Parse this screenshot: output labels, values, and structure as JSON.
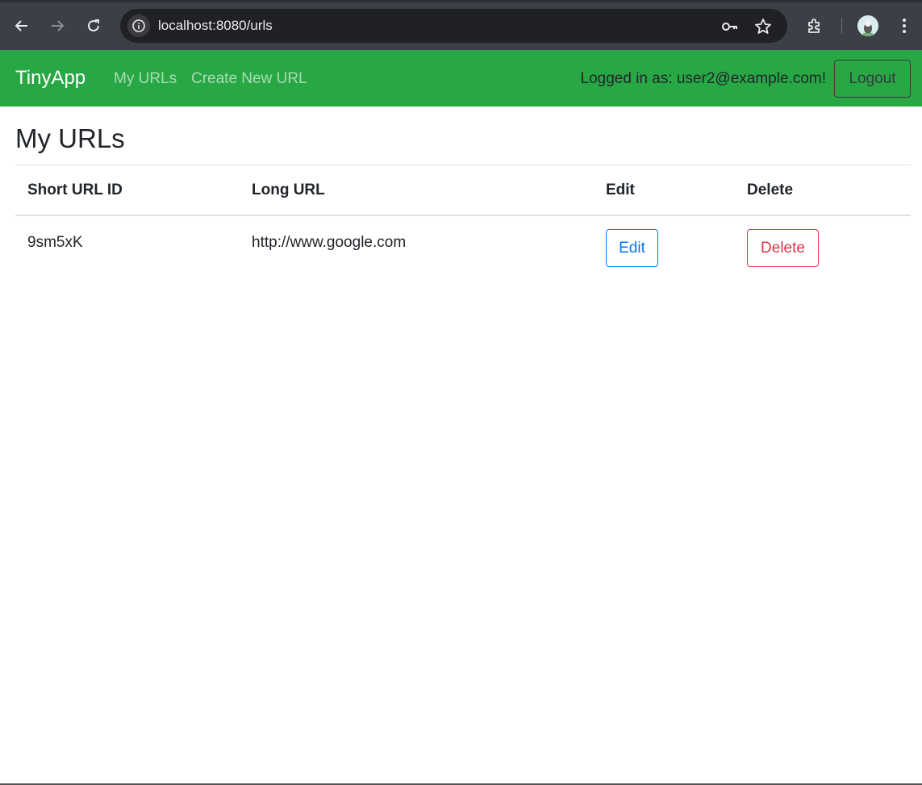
{
  "browser": {
    "url": "localhost:8080/urls",
    "icons": [
      "back-arrow-icon",
      "forward-arrow-icon",
      "reload-icon",
      "site-info-icon",
      "password-key-icon",
      "bookmark-star-icon",
      "extensions-icon",
      "profile-avatar",
      "menu-dots-icon"
    ]
  },
  "navbar": {
    "brand": "TinyApp",
    "links": [
      "My URLs",
      "Create New URL"
    ],
    "logged_in_text": "Logged in as: user2@example.com!",
    "logout_label": "Logout",
    "color": "#28a745"
  },
  "main": {
    "title": "My URLs",
    "table": {
      "headers": [
        "Short URL ID",
        "Long URL",
        "Edit",
        "Delete"
      ],
      "rows": [
        {
          "short_id": "9sm5xK",
          "long_url": "http://www.google.com",
          "edit_label": "Edit",
          "delete_label": "Delete"
        }
      ]
    }
  }
}
